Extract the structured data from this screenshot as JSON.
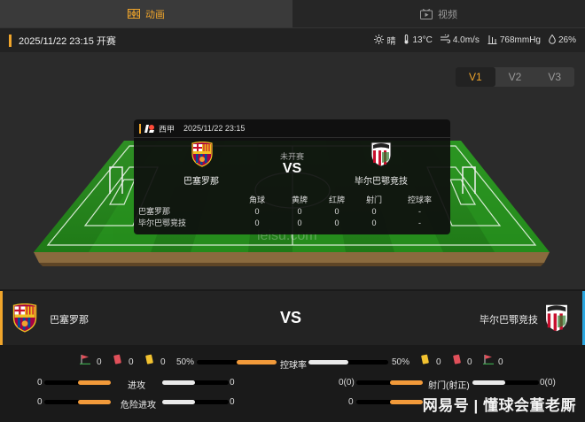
{
  "tabs": [
    {
      "label": "动画",
      "icon": "field-icon",
      "active": true
    },
    {
      "label": "视频",
      "icon": "video-icon",
      "active": false
    }
  ],
  "info": {
    "datetime": "2025/11/22 23:15 开赛",
    "weather": "晴",
    "temperature": "13°C",
    "wind": "4.0m/s",
    "pressure": "768mmHg",
    "humidity": "26%"
  },
  "versions": [
    "V1",
    "V2",
    "V3"
  ],
  "active_version": "V1",
  "watermark_field": "leisu.com",
  "card": {
    "league": "西甲",
    "datetime": "2025/11/22 23:15",
    "status": "未开赛",
    "vs": "VS",
    "home": "巴塞罗那",
    "away": "毕尔巴鄂竞技",
    "columns": [
      "角球",
      "黄牌",
      "红牌",
      "射门",
      "控球率"
    ],
    "rows": [
      {
        "team": "巴塞罗那",
        "values": [
          "0",
          "0",
          "0",
          "0",
          "-"
        ]
      },
      {
        "team": "毕尔巴鄂竞技",
        "values": [
          "0",
          "0",
          "0",
          "0",
          "-"
        ]
      }
    ]
  },
  "teams": {
    "home": "巴塞罗那",
    "away": "毕尔巴鄂竞技",
    "vs": "VS"
  },
  "stats": {
    "home_corner": "0",
    "home_red": "0",
    "home_yellow": "0",
    "home_possession": "50%",
    "possession_label": "控球率",
    "away_possession": "50%",
    "away_yellow": "0",
    "away_red": "0",
    "away_corner": "0",
    "attack_label": "进攻",
    "attack_home": "0",
    "attack_away": "0",
    "danger_label": "危险进攻",
    "danger_home": "0",
    "danger_away": "0",
    "shots_label": "射门(射正)",
    "shots_home": "0(0)",
    "shots_away": "0(0)",
    "row3_right_home": "0"
  },
  "colors": {
    "accent": "#f0a52b",
    "home_bar": "#f29a3a",
    "away_bar": "#eaeaea",
    "away_edge": "#2aa6e0"
  },
  "footer_watermark": "网易号 | 懂球会董老厮"
}
